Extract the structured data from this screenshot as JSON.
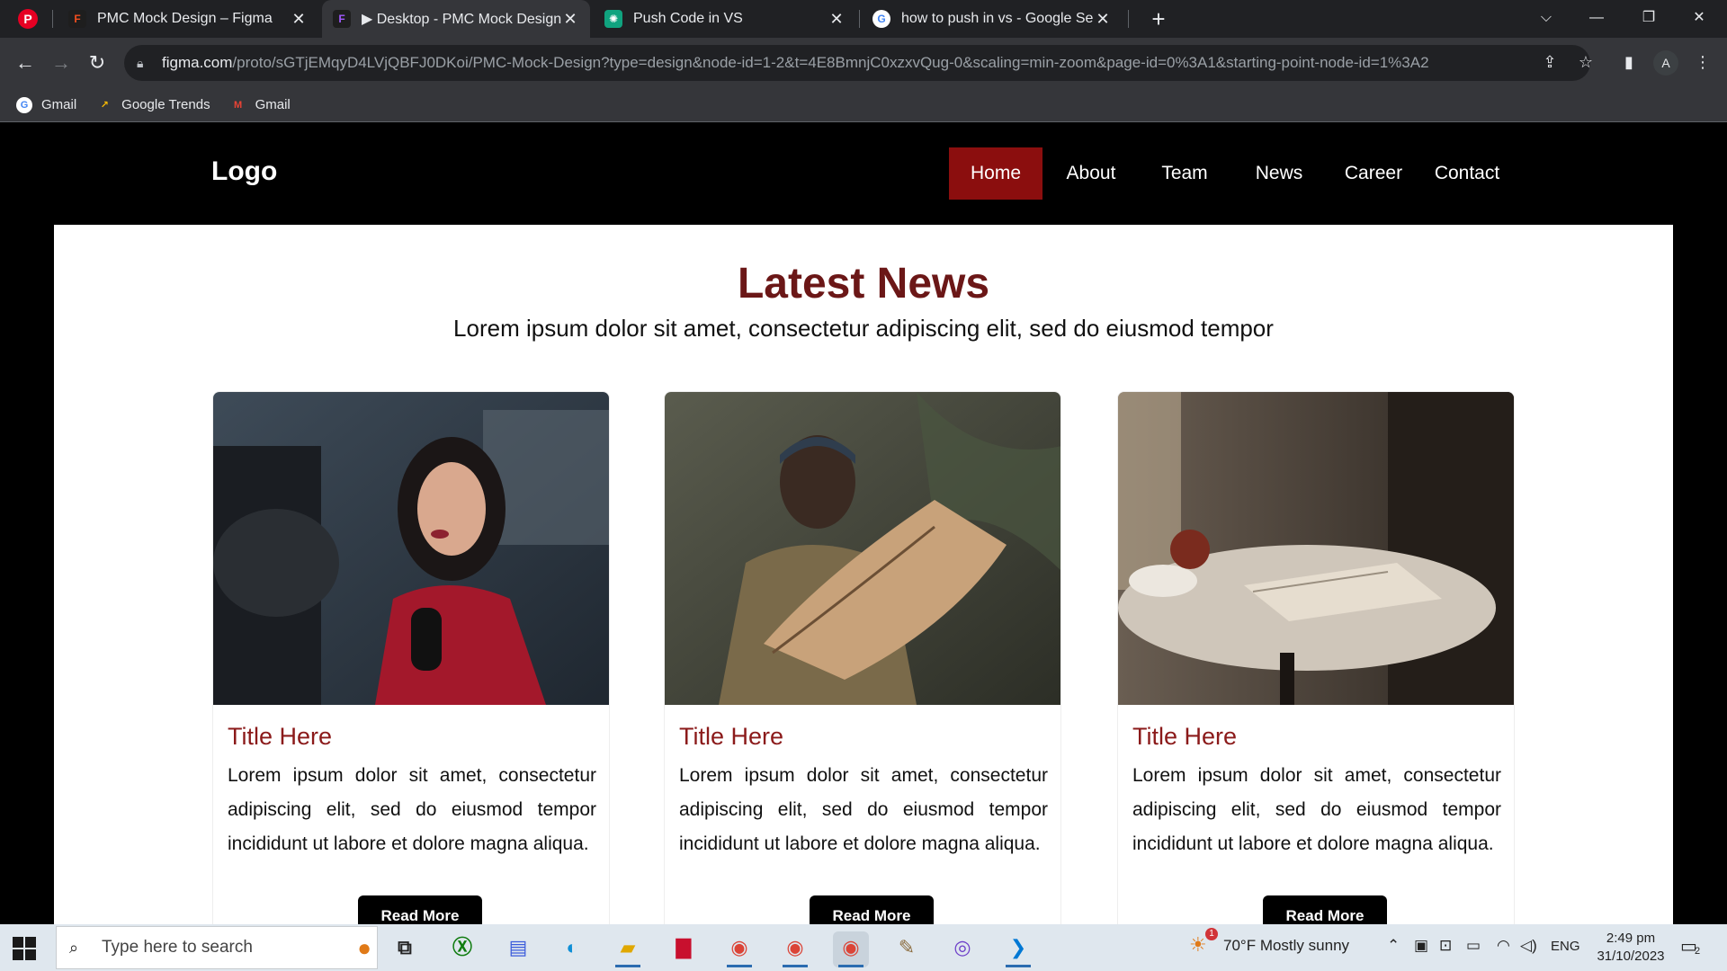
{
  "browser": {
    "tabs": [
      {
        "title": "PMC Mock Design – Figma",
        "icon": "figma-icon"
      },
      {
        "title": "▶ Desktop - PMC Mock Design",
        "icon": "figma-icon"
      },
      {
        "title": "Push Code in VS",
        "icon": "chatgpt-icon"
      },
      {
        "title": "how to push in vs - Google Sear",
        "icon": "google-icon"
      }
    ],
    "url_host": "figma.com",
    "url_path": "/proto/sGTjEMqyD4LVjQBFJ0DKoi/PMC-Mock-Design?type=design&node-id=1-2&t=4E8BmnjC0xzxvQug-0&scaling=min-zoom&page-id=0%3A1&starting-point-node-id=1%3A2",
    "profile_initial": "A",
    "bookmarks": [
      "Gmail",
      "Google Trends",
      "Gmail"
    ]
  },
  "site": {
    "logo": "Logo",
    "nav": [
      "Home",
      "About",
      "Team",
      "News",
      "Career",
      "Contact"
    ],
    "active_nav": "Home",
    "section_title": "Latest News",
    "section_subtitle": "Lorem ipsum dolor sit amet, consectetur adipiscing elit, sed do eiusmod tempor",
    "cards": [
      {
        "title": "Title Here",
        "text": "Lorem ipsum dolor sit amet, consectetur adipiscing elit, sed do eiusmod tempor incididunt ut labore et dolore magna aliqua.",
        "button": "Read More"
      },
      {
        "title": "Title Here",
        "text": "Lorem ipsum dolor sit amet, consectetur adipiscing elit, sed do eiusmod tempor incididunt ut labore et dolore magna aliqua.",
        "button": "Read More"
      },
      {
        "title": "Title Here",
        "text": "Lorem ipsum dolor sit amet, consectetur adipiscing elit, sed do eiusmod tempor incididunt ut labore et dolore magna aliqua.",
        "button": "Read More"
      }
    ]
  },
  "colors": {
    "accent": "#8b0e0e",
    "title": "#6b1717",
    "card_title": "#8b1a1a"
  },
  "taskbar": {
    "search_placeholder": "Type here to search",
    "weather": "70°F  Mostly sunny",
    "language": "ENG",
    "time": "2:49 pm",
    "date": "31/10/2023",
    "notification_count": "2",
    "weather_badge": "1"
  }
}
